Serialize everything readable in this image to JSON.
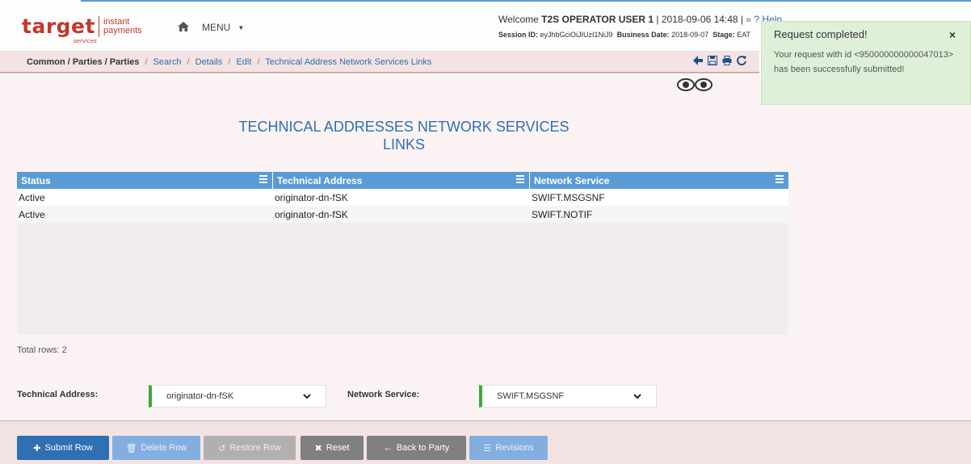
{
  "header": {
    "logo_word": "target",
    "logo_services": "services",
    "logo_sub_1": "instant",
    "logo_sub_2": "payments",
    "menu_label": "MENU",
    "welcome_prefix": "Welcome",
    "user": "T2S OPERATOR USER 1",
    "datetime": "| 2018-09-06 14:48 |",
    "help": "» ? Help",
    "session_label": "Session ID:",
    "session_id": "eyJhbGciOiJIUzI1NiJ9",
    "business_date_label": "Business Date:",
    "business_date": "2018-09-07",
    "stage_label": "Stage:",
    "stage": "EAT"
  },
  "breadcrumb": {
    "root": "Common / Parties / Parties",
    "items": [
      "Search",
      "Details",
      "Edit",
      "Technical Address Network Services Links"
    ]
  },
  "toolbar": {
    "icons": [
      "arrow-left-icon",
      "save-icon",
      "print-icon",
      "refresh-icon"
    ]
  },
  "page": {
    "title_line1": "TECHNICAL ADDRESSES NETWORK SERVICES",
    "title_line2": "LINKS"
  },
  "grid": {
    "columns": [
      "Status",
      "Technical Address",
      "Network Service"
    ],
    "rows": [
      [
        "Active",
        "originator-dn-fSK",
        "SWIFT.MSGSNF"
      ],
      [
        "Active",
        "originator-dn-fSK",
        "SWIFT.NOTIF"
      ]
    ],
    "total": "Total rows: 2"
  },
  "form": {
    "technical_address_label": "Technical Address:",
    "technical_address_value": "originator-dn-fSK",
    "network_service_label": "Network Service:",
    "network_service_value": "SWIFT.MSGSNF"
  },
  "toast": {
    "title": "Request completed!",
    "close": "×",
    "body": "Your request with id <950000000000047013> has been successfully submitted!"
  },
  "buttons": {
    "submit_row": "Submit Row",
    "delete_row": "Delete Row",
    "restore_row": "Restore Row",
    "reset": "Reset",
    "back_to_party": "Back to Party",
    "revisions": "Revisions"
  },
  "colors": {
    "brand_red": "#c0392b",
    "grid_header": "#5b9bd5",
    "primary_button": "#2f6fb3",
    "toast_bg": "#dff0d8",
    "required_marker": "#3aaa3a"
  }
}
